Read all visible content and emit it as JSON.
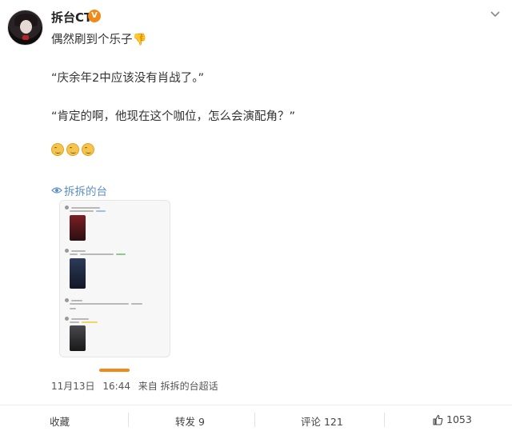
{
  "user": {
    "name": "拆台CT",
    "verified_icon": "verified-badge-icon",
    "verified_color": "#f28a1a"
  },
  "post": {
    "line1": "偶然刷到个乐子👎",
    "line2": "“庆余年2中应该没有肖战了。”",
    "line3": "“肯定的啊，他现在这个咖位，怎么会演配角？”",
    "topic": "拆拆的台"
  },
  "meta": {
    "date": "11月13日",
    "time": "16:44",
    "source": "来自 拆拆的台超话"
  },
  "actions": {
    "favorite": "收藏",
    "repost": "转发 9",
    "comment": "评论 121",
    "like": "1053"
  },
  "colors": {
    "link": "#5b8fc6",
    "accent": "#f28a1a"
  }
}
